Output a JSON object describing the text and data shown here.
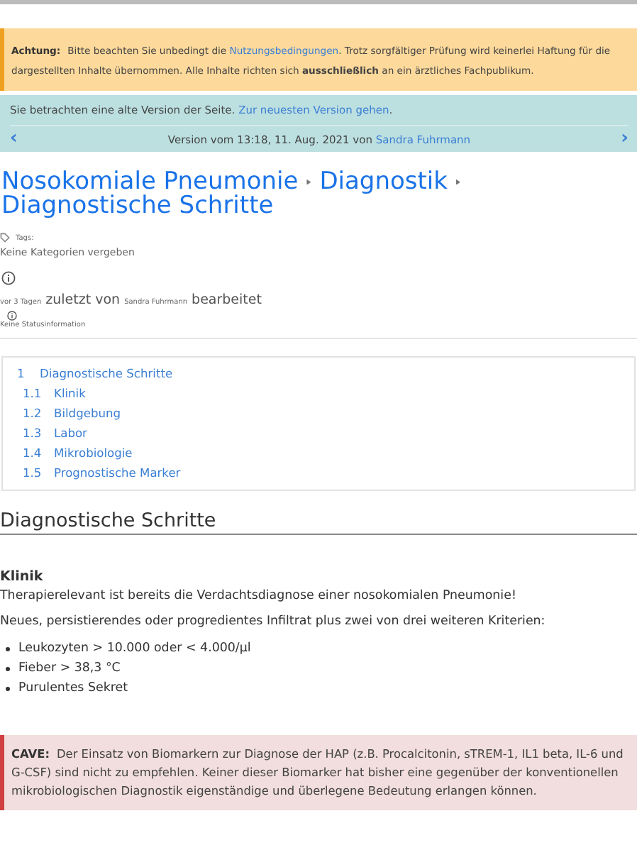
{
  "notice": {
    "label": "Achtung:",
    "segments": [
      {
        "kind": "text",
        "text": "Bitte beachten Sie unbedingt die "
      },
      {
        "kind": "link",
        "text": "Nutzungsbedingungen"
      },
      {
        "kind": "text",
        "text": ". Trotz sorgfältiger Prüfung wird keinerlei Haftung für die dargestellten Inhalte übernommen. Alle Inhalte richten sich **ausschließlich** an ein ärztliches Fachpublikum."
      }
    ]
  },
  "version_notice": {
    "segments": [
      {
        "kind": "text",
        "text": "Sie betrachten eine alte Version der Seite. "
      },
      {
        "kind": "link",
        "text": "Zur neuesten Version gehen"
      },
      {
        "kind": "text",
        "text": "."
      }
    ],
    "nav": {
      "prev": "‹",
      "next": "›",
      "text": "Version vom 13:18, 11. Aug. 2021 von ",
      "author": "Sandra Fuhrmann"
    }
  },
  "breadcrumb": [
    "Nosokomiale Pneumonie",
    "Diagnostik",
    "Diagnostische Schritte"
  ],
  "meta": {
    "tags_label": "Tags:",
    "tags_value": "Keine Kategorien vergeben",
    "edited_when": "vor 3 Tagen",
    "edited_mid": "zuletzt von",
    "edited_who": "Sandra Fuhrmann",
    "edited_end": "bearbeitet",
    "status": "Keine Statusinformation"
  },
  "toc": [
    {
      "number": "1",
      "label": "Diagnostische Schritte",
      "children": [
        {
          "number": "1.1",
          "label": "Klinik"
        },
        {
          "number": "1.2",
          "label": "Bildgebung"
        },
        {
          "number": "1.3",
          "label": "Labor"
        },
        {
          "number": "1.4",
          "label": "Mikrobiologie"
        },
        {
          "number": "1.5",
          "label": "Prognostische Marker"
        }
      ]
    }
  ],
  "section": {
    "heading": "Diagnostische Schritte",
    "subheading": "Klinik",
    "paragraphs": [
      "Therapierelevant ist bereits die Verdachtsdiagnose einer nosokomialen Pneumonie!",
      "Neues, persistierendes oder progredientes Infiltrat plus zwei von drei weiteren Kriterien:"
    ],
    "bullets": [
      "Leukozyten > 10.000 oder < 4.000/µl",
      "Fieber > 38,3 °C",
      "Purulentes Sekret"
    ]
  },
  "cave": {
    "label": "CAVE:",
    "text": "Der Einsatz von Biomarkern zur Diagnose der HAP (z.B. Procalcitonin, sTREM-1, IL1 beta, IL-6 und G-CSF) sind nicht zu empfehlen. Keiner dieser Biomarker hat bisher eine gegenüber der konventionellen mikrobiologischen Diagnostik eigenständige und überlegene Bedeutung erlangen können."
  }
}
